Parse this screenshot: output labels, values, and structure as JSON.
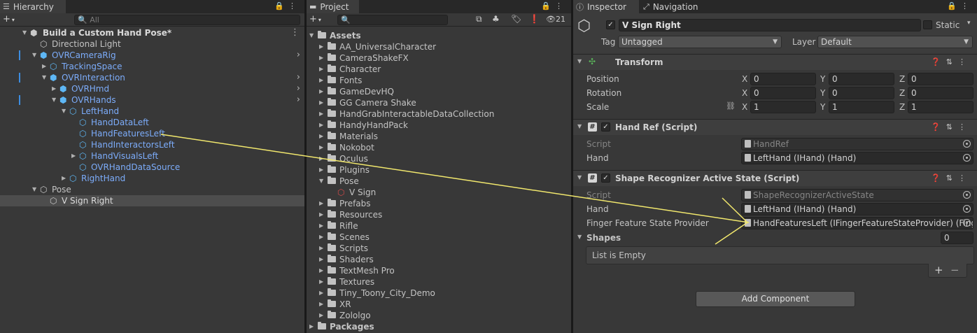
{
  "hierarchy": {
    "tab": "Hierarchy",
    "search_placeholder": "All",
    "scene": "Build a Custom Hand Pose*",
    "items": [
      {
        "label": "Directional Light"
      },
      {
        "label": "OVRCameraRig"
      },
      {
        "label": "TrackingSpace"
      },
      {
        "label": "OVRInteraction"
      },
      {
        "label": "OVRHmd"
      },
      {
        "label": "OVRHands"
      },
      {
        "label": "LeftHand"
      },
      {
        "label": "HandDataLeft"
      },
      {
        "label": "HandFeaturesLeft"
      },
      {
        "label": "HandInteractorsLeft"
      },
      {
        "label": "HandVisualsLeft"
      },
      {
        "label": "OVRHandDataSource"
      },
      {
        "label": "RightHand"
      },
      {
        "label": "Pose"
      },
      {
        "label": "V Sign Right"
      }
    ]
  },
  "project": {
    "tab": "Project",
    "hidden_count": "21",
    "root": "Assets",
    "folders": [
      "AA_UniversalCharacter",
      "CameraShakeFX",
      "Character",
      "Fonts",
      "GameDevHQ",
      "GG Camera Shake",
      "HandGrabInteractableDataCollection",
      "HandyHandPack",
      "Materials",
      "Nokobot",
      "Oculus",
      "Plugins",
      "Pose"
    ],
    "pose_child": "V Sign",
    "folders_after": [
      "Prefabs",
      "Resources",
      "Rifle",
      "Scenes",
      "Scripts",
      "Shaders",
      "TextMesh Pro",
      "Textures",
      "Tiny_Toony_City_Demo",
      "XR",
      "Zololgo"
    ],
    "packages": "Packages"
  },
  "inspector": {
    "tab": "Inspector",
    "tab2": "Navigation",
    "object_name": "V Sign Right",
    "static_label": "Static",
    "tag_label": "Tag",
    "tag_value": "Untagged",
    "layer_label": "Layer",
    "layer_value": "Default",
    "transform": {
      "title": "Transform",
      "position_label": "Position",
      "rotation_label": "Rotation",
      "scale_label": "Scale",
      "position": {
        "x": "0",
        "y": "0",
        "z": "0"
      },
      "rotation": {
        "x": "0",
        "y": "0",
        "z": "0"
      },
      "scale": {
        "x": "1",
        "y": "1",
        "z": "1"
      }
    },
    "handref": {
      "title": "Hand Ref (Script)",
      "script_label": "Script",
      "script_value": "HandRef",
      "hand_label": "Hand",
      "hand_value": "LeftHand (IHand) (Hand)"
    },
    "shape": {
      "title": "Shape Recognizer Active State (Script)",
      "script_label": "Script",
      "script_value": "ShapeRecognizerActiveState",
      "hand_label": "Hand",
      "hand_value": "LeftHand (IHand) (Hand)",
      "provider_label": "Finger Feature State Provider",
      "provider_value": "HandFeaturesLeft (IFingerFeatureStateProvider) (Fing",
      "shapes_label": "Shapes",
      "shapes_count": "0",
      "list_empty": "List is Empty"
    },
    "add_component": "Add Component"
  },
  "axes": {
    "x": "X",
    "y": "Y",
    "z": "Z"
  },
  "colors": {
    "annotation": "#f2e86d",
    "link_blue": "#7cacfa",
    "selection": "#4d4d4d"
  }
}
